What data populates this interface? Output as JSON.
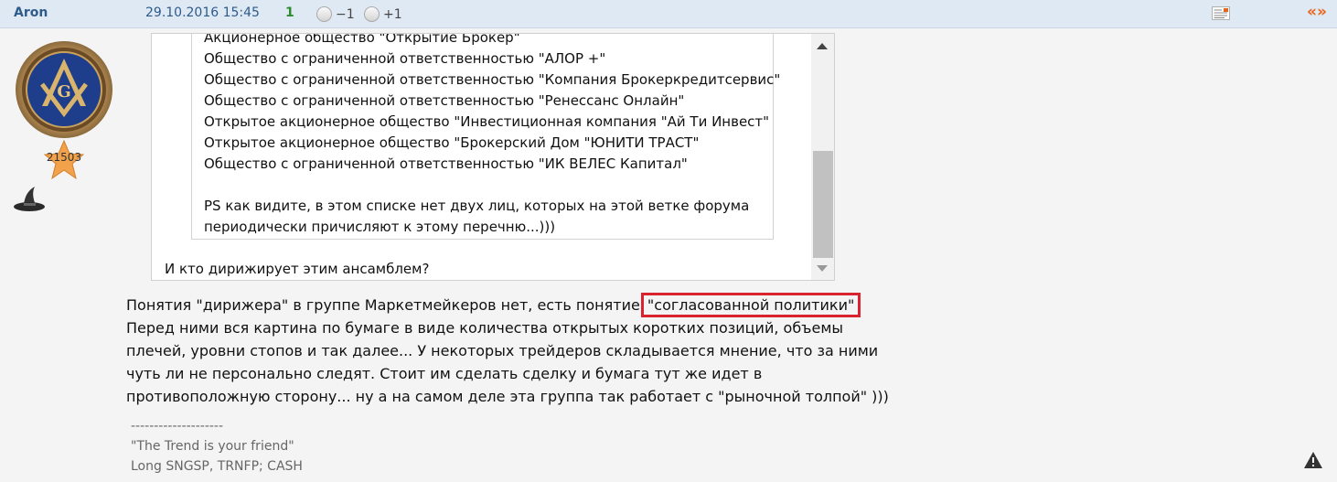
{
  "post": {
    "author": "Aron",
    "datetime": "29.10.2016 15:45",
    "rating": "1",
    "vote_minus": "−1",
    "vote_plus": "+1",
    "quote_symbol": "«»"
  },
  "profile": {
    "score": "21503"
  },
  "quote": {
    "inner_lines": [
      "Акционерное общество \"Открытие Брокер\"",
      "Общество с ограниченной ответственностью \"АЛОР +\"",
      "Общество с ограниченной ответственностью \"Компания Брокеркредитсервис\"",
      "Общество с ограниченной ответственностью \"Ренессанс Онлайн\"",
      "Открытое акционерное общество \"Инвестиционная компания \"Ай Ти Инвест\"",
      "Открытое акционерное общество \"Брокерский Дом \"ЮНИТИ ТРАСТ\"",
      "Общество с ограниченной ответственностью \"ИК ВЕЛЕС Капитал\"",
      "",
      "PS как видите, в этом списке нет двух лиц, которых на этой ветке форума",
      "периодически причисляют к этому перечню...)))"
    ],
    "question": "И кто дирижирует этим ансамблем?"
  },
  "reply": {
    "line1_before": "Понятия \"дирижера\" в группе Маркетмейкеров нет, есть понятие ",
    "line1_highlight": "\"согласованной политики\"",
    "lines": [
      "Перед ними вся картина по бумаге в виде количества открытых коротких позиций, объемы",
      "плечей, уровни стопов и так далее... У некоторых трейдеров складывается мнение, что за ними",
      "чуть ли не персонально следят. Стоит им сделать сделку и бумага тут же идет в",
      "противоположную сторону... ну а на самом деле эта группа так работает с \"рыночной толпой\" )))"
    ]
  },
  "signature": {
    "lines": [
      "--------------------",
      "\"The Trend is your friend\"",
      "Long SNGSP, TRNFP; CASH"
    ]
  },
  "icons": {
    "doc": "document-icon",
    "quote": "quote-icon",
    "warning": "warning-icon",
    "avatar": "masonic-emblem-avatar",
    "star": "star-icon",
    "hat": "wizard-hat-icon"
  },
  "colors": {
    "header_bg": "#dfe9f4",
    "author": "#2d5b8a",
    "rating": "#2d8a2d",
    "quote_accent": "#e8631a",
    "highlight_border": "#d9232e"
  }
}
